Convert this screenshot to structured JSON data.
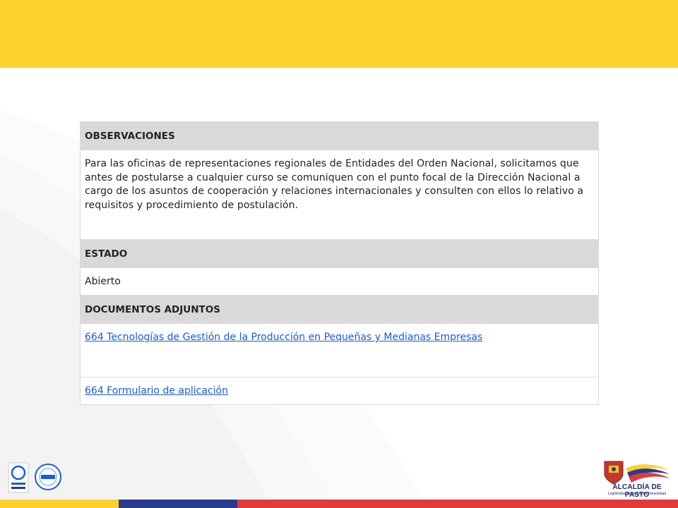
{
  "colors": {
    "top_band": "#fdd12d",
    "header_row": "#d9d9d9",
    "link": "#1a5bd6",
    "strip": [
      "#fdd12d",
      "#2a3b8f",
      "#e23a3a"
    ]
  },
  "table": {
    "observaciones_label": "OBSERVACIONES",
    "observaciones_text": "Para las oficinas de representaciones regionales de Entidades del Orden Nacional, solicitamos que antes de postularse a cualquier curso se comuniquen con el punto focal de la Dirección Nacional a cargo de los asuntos de cooperación y relaciones internacionales y consulten con ellos lo relativo a requisitos y procedimiento de postulación.",
    "estado_label": "ESTADO",
    "estado_value": "Abierto",
    "documentos_label": "DOCUMENTOS ADJUNTOS",
    "documents": [
      {
        "label": "664 Tecnologías de Gestión de la Producción en Pequeñas y Medianas Empresas"
      },
      {
        "label": "664 Formulario de aplicación"
      }
    ]
  },
  "footer": {
    "right_logo_title": "ALCALDÍA DE PASTO",
    "right_logo_subtitle": "Legitimidad Participación Honestidad",
    "left_logo_icons": [
      "certification-seal-icon",
      "certification-seal-icon"
    ]
  }
}
